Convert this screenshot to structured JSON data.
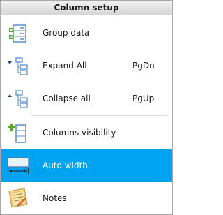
{
  "menu": {
    "title": "Column setup",
    "items": [
      {
        "label": "Group data",
        "shortcut": "",
        "icon": "group-data-icon",
        "selected": false
      },
      {
        "label": "Expand All",
        "shortcut": "PgDn",
        "icon": "expand-all-icon",
        "selected": false
      },
      {
        "label": "Collapse all",
        "shortcut": "PgUp",
        "icon": "collapse-all-icon",
        "selected": false
      },
      {
        "label": "Columns visibility",
        "shortcut": "",
        "icon": "columns-visibility-icon",
        "selected": false
      },
      {
        "label": "Auto width",
        "shortcut": "",
        "icon": "auto-width-icon",
        "selected": true
      },
      {
        "label": "Notes",
        "shortcut": "",
        "icon": "notes-icon",
        "selected": false
      }
    ]
  },
  "colors": {
    "selected_background": "#00a3f0",
    "icon_green": "#5aa832",
    "icon_blue": "#5d8ec6"
  }
}
